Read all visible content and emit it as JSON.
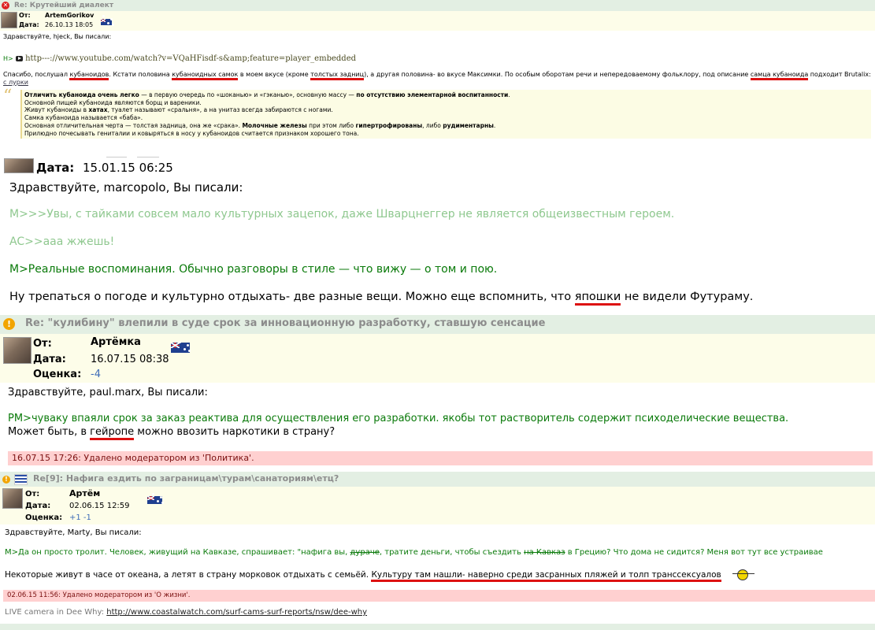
{
  "post1": {
    "title": "Re: Крутейший диалект",
    "from_label": "От:",
    "author": "ArtemGorikov",
    "date_label": "Дата:",
    "date": "26.10.13 18:05",
    "greeting": "Здравствуйте, hjeck, Вы писали:",
    "link_prefix": "H>",
    "link_url": "http---://www.youtube.com/watch?v=VQaHFisdf-s&amp;feature=player_embedded",
    "body_parts": [
      "Спасибо, послушал ",
      "кубаноидов",
      ". Кстати половина ",
      "кубаноидных самок",
      " в моем вкусе (кроме ",
      "толстых задниц",
      "), а другая половина- во вкусе Максимки. По особым оборотам речи и непередоваемому фольклору, под описание ",
      "самца кубаноида",
      " подходит Brutalix:"
    ],
    "lurk_link": "с лурки",
    "quote_lines": [
      {
        "b": "Отличить кубаноида очень легко",
        "t": " — в первую очередь по «шоканью» и «гэканью», основную массу — ",
        "b2": "по отсутствию элементарной воспитанности",
        "t2": "."
      },
      {
        "t": "Основной пищей кубаноида являются борщ и вареники."
      },
      {
        "t": "Живут кубаноиды в ",
        "b": "хатах",
        "t2": ", туалет называют «сральня», а на унитаз всегда забираются с ногами."
      },
      {
        "t": "Самка кубаноида называется «баба»."
      },
      {
        "t": "Основная отличительная черта — толстая задница, она же «срака». ",
        "b": "Молочные железы",
        "t2": " при этом либо ",
        "b2": "гипертрофированы",
        "t3": ", либо ",
        "b3": "рудиментарны",
        "t4": "."
      },
      {
        "t": "Прилюдно почесывать гениталии и ковыряться в носу у кубаноидов считается признаком хорошего тона."
      }
    ]
  },
  "post2": {
    "date_label": "Дата:",
    "date": "15.01.15 06:25",
    "greeting": "Здравствуйте, marcopolo, Вы писали:",
    "quote1": "M>>>Увы, с тайками совсем мало культурных зацепок, даже Шварцнеггер не является общеизвестным героем.",
    "quote2": "AC>>ааа жжешь!",
    "quote3": "M>Реальные воспоминания. Обычно разговоры в стиле — что вижу — о том и пою.",
    "reply_before": "Ну трепаться о погоде и культурно отдыхать- две разные вещи. Можно еще вспомнить, что ",
    "reply_ul": "япошки",
    "reply_after": " не видели Футураму."
  },
  "post3": {
    "title": "Re: \"кулибину\" влепили в суде срок за инновационную разработку, ставшую сенсацие",
    "from_label": "От:",
    "author": "Артёмка",
    "date_label": "Дата:",
    "date": "16.07.15 08:38",
    "score_label": "Оценка:",
    "score": "-4",
    "greeting": "Здравствуйте, paul.marx, Вы писали:",
    "quote": "PM>чуваку впаяли срок за заказ реактива для осуществления его разработки. якобы тот растворитель содержит психоделические вещества.",
    "reply_before": "Может быть, в ",
    "reply_ul": "гейропе",
    "reply_after": " можно ввозить наркотики в страну?",
    "moderation": "16.07.15 17:26: Удалено модератором из 'Политика'."
  },
  "post4": {
    "title": "Re[9]: Нафига ездить по заграницам\\турам\\санаториям\\етц?",
    "from_label": "От:",
    "author": "Артём",
    "date_label": "Дата:",
    "date": "02.06.15 12:59",
    "score_label": "Оценка:",
    "score": "+1 -1",
    "greeting": "Здравствуйте, Marty, Вы писали:",
    "quote_before": "M>Да он просто тролит. Человек, живущий на Кавказе, спрашивает: \"нафига вы, ",
    "quote_strike1": "дураче",
    "quote_mid": ", тратите деньги, чтобы съездить ",
    "quote_strike2": "на Кавказ",
    "quote_after": " в Грецию? Что дома не сидится? Меня вот тут все устраивае",
    "reply_before": "Некоторые живут в часе от океана, а летят в страну морковок отдыхать с семьёй. ",
    "reply_ul": "Культуру там нашли- наверно среди засранных пляжей и толп транссексуалов",
    "moderation": "02.06.15 11:56: Удалено модератором из 'О жизни'.",
    "sig_text": "LIVE camera in Dee Why: ",
    "sig_link": "http://www.coastalwatch.com/surf-cams-surf-reports/nsw/dee-why"
  }
}
